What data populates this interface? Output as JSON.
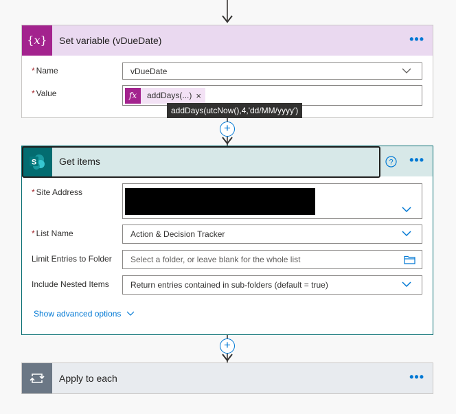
{
  "set_variable": {
    "title": "Set variable (vDueDate)",
    "icon": "variable-icon",
    "accent": "#a3238e",
    "header_bg": "#ead9f0",
    "name_label": "Name",
    "name_value": "vDueDate",
    "value_label": "Value",
    "value_token": "addDays(...)",
    "token_icon_text": "fx",
    "token_close": "×",
    "tooltip": "addDays(utcNow(),4,'dd/MM/yyyy')"
  },
  "get_items": {
    "title": "Get items",
    "icon": "sharepoint-icon",
    "accent": "#036c70",
    "header_bg": "#d7e8e8",
    "help_icon": "help-icon",
    "site_address_label": "Site Address",
    "site_address_value": "",
    "list_name_label": "List Name",
    "list_name_value": "Action & Decision Tracker",
    "limit_label": "Limit Entries to Folder",
    "limit_placeholder": "Select a folder, or leave blank for the whole list",
    "nested_label": "Include Nested Items",
    "nested_value": "Return entries contained in sub-folders (default = true)",
    "advanced_link": "Show advanced options"
  },
  "apply_each": {
    "title": "Apply to each",
    "icon": "loop-icon",
    "accent": "#6b7785",
    "header_bg": "#e8ebef"
  },
  "more_menu": "•••",
  "required_mark": "*",
  "plus": "+"
}
